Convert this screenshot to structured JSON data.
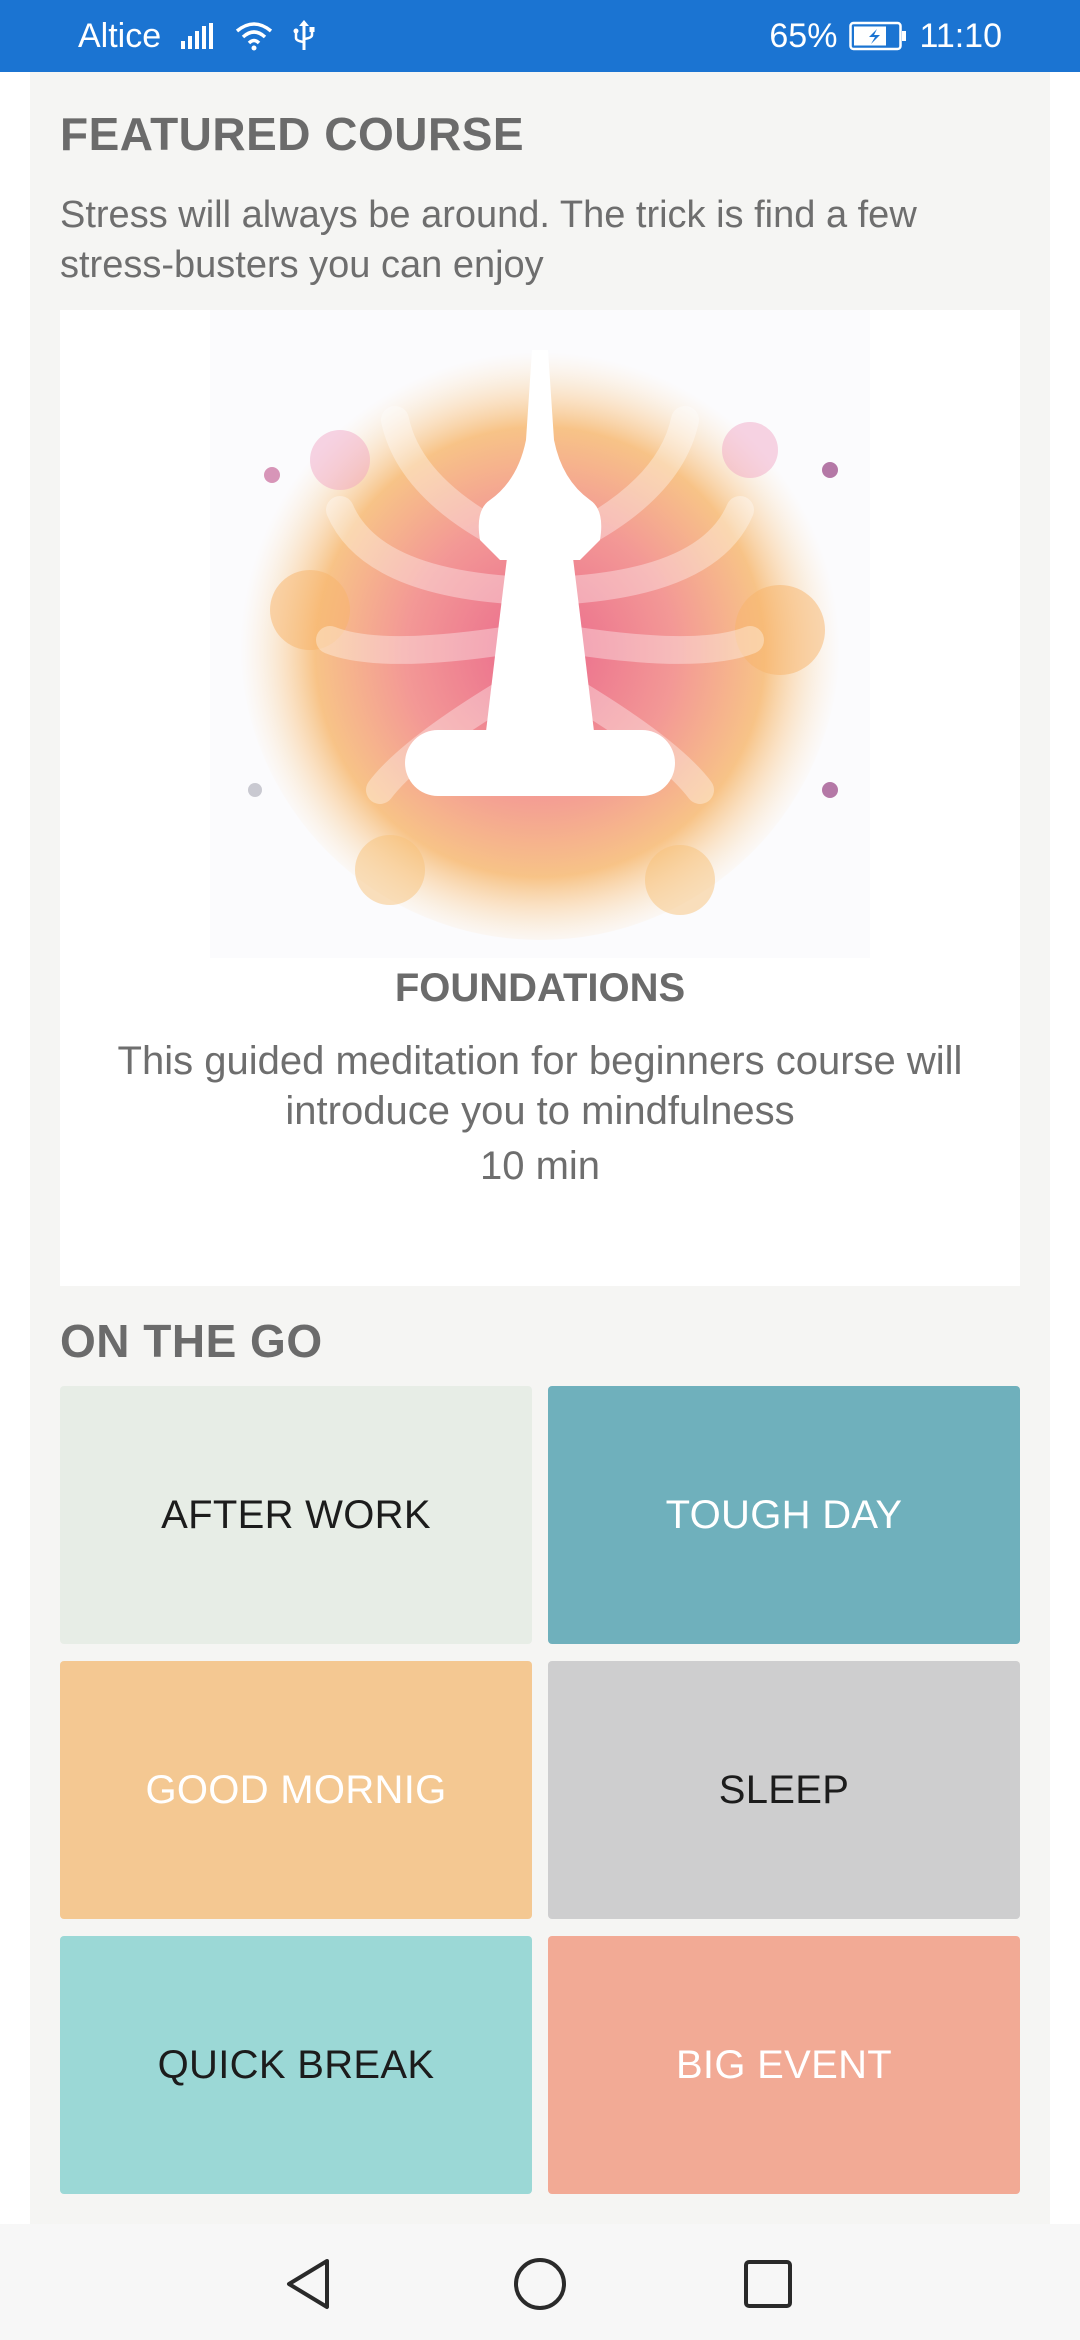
{
  "status_bar": {
    "carrier": "Altice",
    "battery": "65%",
    "time": "11:10",
    "icons": [
      "signal-icon",
      "wifi-icon",
      "usb-icon",
      "battery-icon"
    ]
  },
  "featured": {
    "heading": "FEATURED COURSE",
    "subtitle": "Stress will always be around. The trick is find a few stress-busters you can enjoy",
    "course": {
      "name": "FOUNDATIONS",
      "description": "This guided meditation for beginners course will introduce you to mindfulness",
      "duration": "10 min",
      "image_icon": "meditation-illustration"
    }
  },
  "on_the_go": {
    "heading": "ON THE GO",
    "tiles": [
      {
        "label": "AFTER WORK",
        "bg": "#e7ede6",
        "fg": "#1c1c1c"
      },
      {
        "label": "TOUGH DAY",
        "bg": "#6fb0bc",
        "fg": "#ffffff"
      },
      {
        "label": "GOOD MORNIG",
        "bg": "#f4c892",
        "fg": "#ffffff"
      },
      {
        "label": "SLEEP",
        "bg": "#cececf",
        "fg": "#1c1c1c"
      },
      {
        "label": "QUICK BREAK",
        "bg": "#9bd8d6",
        "fg": "#1c1c1c"
      },
      {
        "label": "BIG EVENT",
        "bg": "#f2aa95",
        "fg": "#ffffff"
      }
    ]
  },
  "nav_bar": {
    "icons": [
      "back-icon",
      "home-icon",
      "recents-icon"
    ]
  },
  "colors": {
    "status_bar": "#1b74d2",
    "panel_bg": "#f5f5f3",
    "heading_text": "#6b6b6b"
  }
}
